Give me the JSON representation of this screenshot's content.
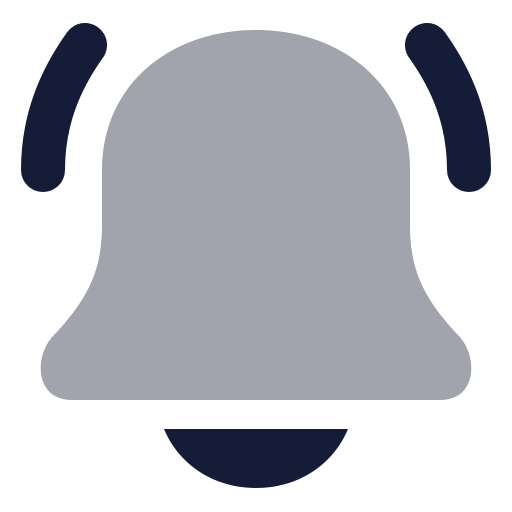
{
  "icon": {
    "name": "bell-ringing-icon",
    "colors": {
      "bell_body": "#a1a3ad",
      "accent": "#141c37",
      "background": "#ffffff"
    }
  }
}
